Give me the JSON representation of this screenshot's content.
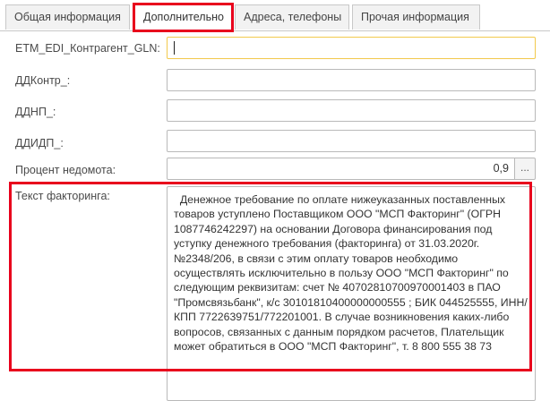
{
  "tabs": [
    {
      "label": "Общая информация",
      "active": false
    },
    {
      "label": "Дополнительно",
      "active": true
    },
    {
      "label": "Адреса, телефоны",
      "active": false
    },
    {
      "label": "Прочая информация",
      "active": false
    }
  ],
  "fields": {
    "gln": {
      "label": "ETM_EDI_Контрагент_GLN:",
      "value": ""
    },
    "ddkontr": {
      "label": "ДДКонтр_:",
      "value": ""
    },
    "ddnp": {
      "label": "ДДНП_:",
      "value": ""
    },
    "ddidp": {
      "label": "ДДИДП_:",
      "value": ""
    },
    "percent": {
      "label": "Процент недомота:",
      "value": "0,9",
      "button": "..."
    },
    "factoring": {
      "label": "Текст факторинга:",
      "value": "  Денежное требование по оплате нижеуказанных поставленных товаров уступлено Поставщиком ООО \"МСП Факторинг\" (ОГРН 1087746242297) на основании Договора финансирования под уступку денежного требования (факторинга) от 31.03.2020г. №2348/206, в связи с этим оплату товаров необходимо осуществлять исключительно в пользу ООО \"МСП Факторинг\" по следующим реквизитам: счет № 40702810700970001403 в ПАО \"Промсвязьбанк\", к/с 30101810400000000555 ; БИК 044525555, ИНН/КПП 7722639751/772201001. В случае возникновения каких-либо вопросов, связанных с данным порядком расчетов, Плательщик может обратиться в ООО \"МСП Факторинг\", т. 8 800 555 38 73"
    }
  },
  "colors": {
    "highlight": "#e8001c",
    "focus_border": "#f2c94c",
    "tab_inactive_bg": "#f2f2f2"
  }
}
